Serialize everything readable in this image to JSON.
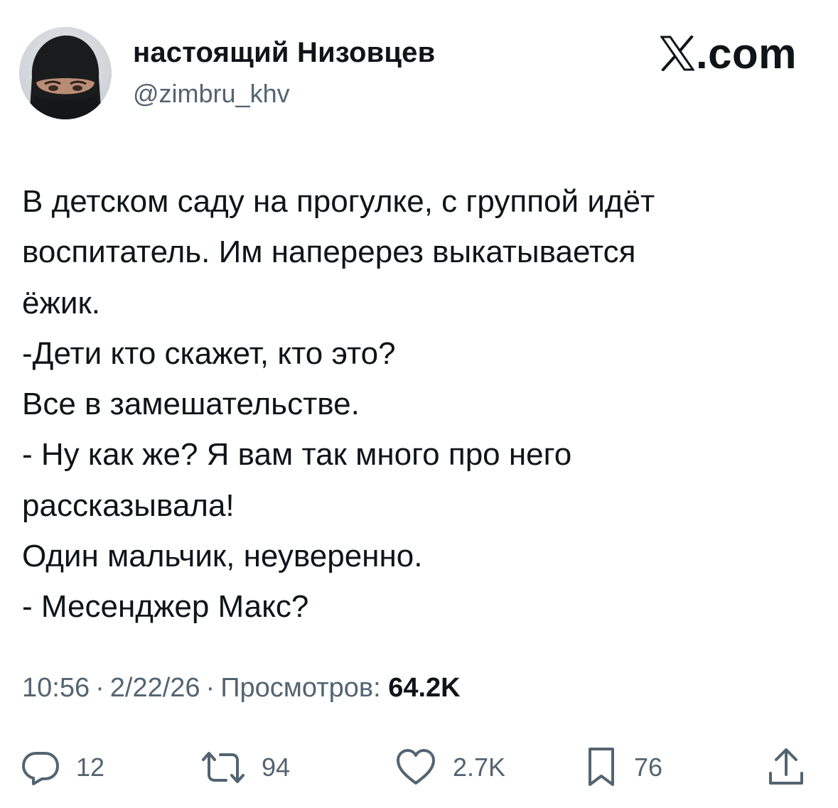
{
  "header": {
    "author_name": "настоящий Низовцев",
    "author_handle": "@zimbru_khv",
    "brand_suffix": ".com",
    "brand_icon": "x-logo-icon"
  },
  "tweet": {
    "lines": [
      "В детском саду на прогулке, с группой идёт",
      "воспитатель. Им наперерез выкатывается",
      "ёжик.",
      "-Дети кто скажет, кто это?",
      "Все в замешательстве.",
      "- Ну как же? Я вам так много про него",
      "рассказывала!",
      "Один мальчик, неуверенно.",
      "- Месенджер Макс?"
    ]
  },
  "meta": {
    "time": "10:56",
    "separator": "·",
    "date": "2/22/26",
    "views_label": "Просмотров:",
    "views_count": "64.2K"
  },
  "actions": {
    "replies": "12",
    "reposts": "94",
    "likes": "2.7K",
    "bookmarks": "76"
  },
  "colors": {
    "text_primary": "#0f1419",
    "text_secondary": "#536471",
    "background": "#ffffff"
  }
}
